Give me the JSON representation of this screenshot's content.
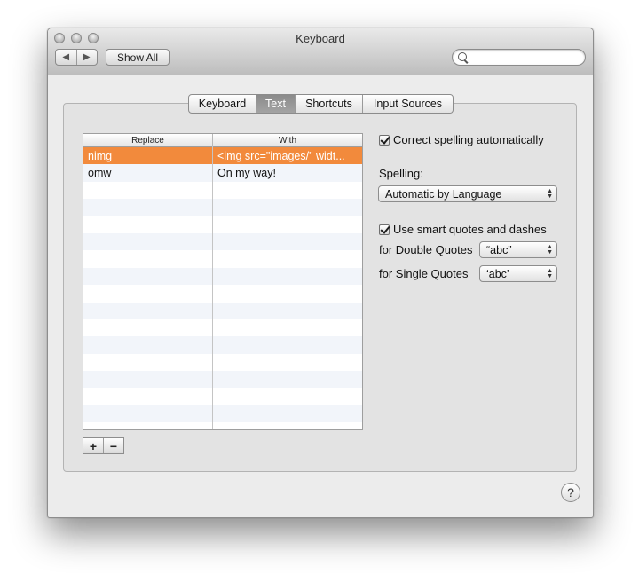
{
  "window": {
    "title": "Keyboard"
  },
  "toolbar": {
    "back": "◀",
    "forward": "▶",
    "show_all": "Show All",
    "search_placeholder": ""
  },
  "tabs": [
    {
      "label": "Keyboard",
      "selected": false
    },
    {
      "label": "Text",
      "selected": true
    },
    {
      "label": "Shortcuts",
      "selected": false
    },
    {
      "label": "Input Sources",
      "selected": false
    }
  ],
  "table": {
    "headers": [
      "Replace",
      "With"
    ],
    "rows": [
      {
        "replace": "nimg",
        "with": "<img src=\"images/\" widt...",
        "selected": true
      },
      {
        "replace": "omw",
        "with": "On my way!",
        "selected": false
      }
    ],
    "add": "+",
    "remove": "−"
  },
  "options": {
    "correct_spelling": {
      "label": "Correct spelling automatically",
      "checked": true
    },
    "spelling_label": "Spelling:",
    "spelling_value": "Automatic by Language",
    "smart_quotes": {
      "label": "Use smart quotes and dashes",
      "checked": true
    },
    "double_quotes_label": "for Double Quotes",
    "double_quotes_value": "“abc”",
    "single_quotes_label": "for Single Quotes",
    "single_quotes_value": "‘abc’"
  },
  "help": "?",
  "colors": {
    "selection": "#f28a3c"
  }
}
